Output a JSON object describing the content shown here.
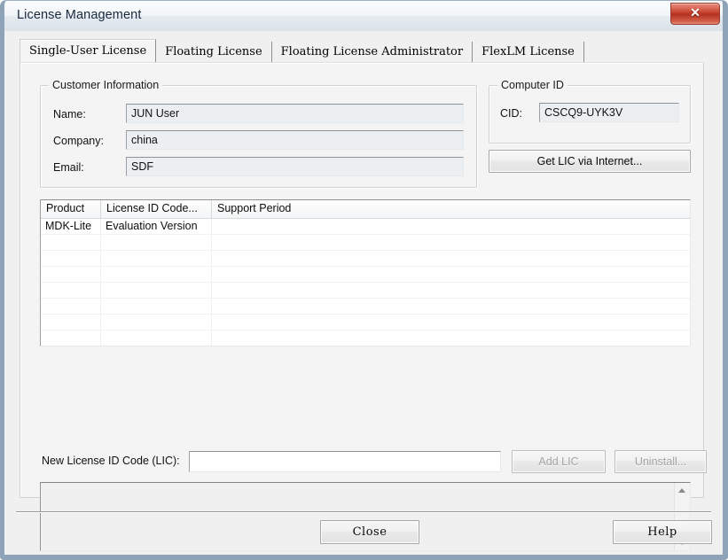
{
  "window": {
    "title": "License Management",
    "close_button_glyph": "✕",
    "accent_close_color": "#c23a27",
    "frame_color": "#8fa3b8"
  },
  "tabs": [
    {
      "label": "Single-User License",
      "active": true
    },
    {
      "label": "Floating License",
      "active": false
    },
    {
      "label": "Floating License Administrator",
      "active": false
    },
    {
      "label": "FlexLM License",
      "active": false
    }
  ],
  "customer_information": {
    "group_title": "Customer Information",
    "fields": [
      {
        "label": "Name:",
        "value": "JUN User"
      },
      {
        "label": "Company:",
        "value": "china"
      },
      {
        "label": "Email:",
        "value": "SDF"
      }
    ]
  },
  "computer_id": {
    "group_title": "Computer ID",
    "cid_label": "CID:",
    "cid_value": "CSCQ9-UYK3V",
    "get_lic_button": "Get LIC via Internet..."
  },
  "license_table": {
    "columns": [
      "Product",
      "License ID Code...",
      "Support Period"
    ],
    "rows": [
      {
        "product": "MDK-Lite",
        "license_id_code": "Evaluation Version",
        "support_period": ""
      }
    ],
    "empty_row_count": 9
  },
  "new_license": {
    "label": "New License ID Code (LIC):",
    "value": "",
    "placeholder": "",
    "add_button": "Add LIC",
    "add_button_enabled": false,
    "uninstall_button": "Uninstall...",
    "uninstall_button_enabled": false
  },
  "log": {
    "text": ""
  },
  "footer": {
    "close_button": "Close",
    "help_button": "Help"
  }
}
